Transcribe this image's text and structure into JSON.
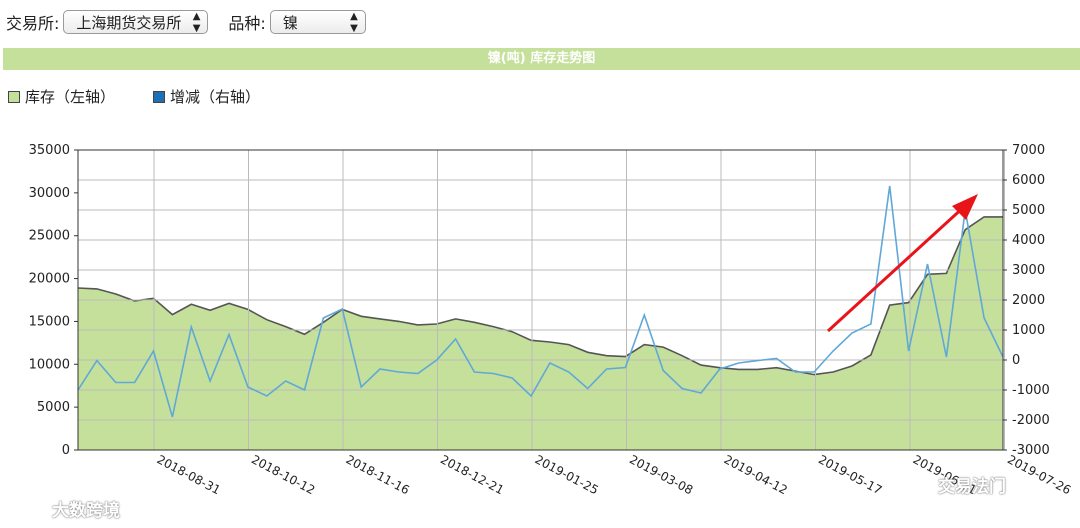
{
  "toolbar": {
    "exchange_label": "交易所:",
    "exchange_value": "上海期货交易所",
    "variety_label": "品种:",
    "variety_value": "镍"
  },
  "colors": {
    "inventory_fill": "#c5e09b",
    "inventory_line": "#555555",
    "change_line": "#5fa8d8",
    "arrow": "#e8141a",
    "grid": "#bbbbbb"
  },
  "watermarks": {
    "left": "大数跨境",
    "right": "交易法门"
  },
  "chart_data": {
    "type": "area",
    "title": "镍(吨)  库存走势图",
    "legend": [
      {
        "name": "库存（左轴）",
        "color": "#c5e09b"
      },
      {
        "name": "增减（右轴）",
        "color": "#1f6fb5"
      }
    ],
    "x_ticks": [
      "2018-08-31",
      "2018-10-12",
      "2018-11-16",
      "2018-12-21",
      "2019-01-25",
      "2019-03-08",
      "2019-04-12",
      "2019-05-17",
      "2019-06-21",
      "2019-07-26"
    ],
    "ylim_left": [
      0,
      35000
    ],
    "yticks_left": [
      "35000",
      "30000",
      "25000",
      "20000",
      "15000",
      "10000",
      "5000",
      "0"
    ],
    "ylim_right": [
      -3000,
      7000
    ],
    "yticks_right": [
      "7000",
      "6000",
      "5000",
      "4000",
      "3000",
      "2000",
      "1000",
      "0",
      "-1000",
      "-2000",
      "-3000"
    ],
    "grid": true,
    "legend_position": "top-left",
    "series": [
      {
        "name": "库存（左轴）",
        "axis": "left",
        "values": [
          18900,
          18800,
          18200,
          17400,
          17700,
          15800,
          17000,
          16300,
          17100,
          16400,
          15200,
          14400,
          13500,
          14900,
          16400,
          15600,
          15300,
          15000,
          14600,
          14700,
          15300,
          14900,
          14400,
          13800,
          12800,
          12600,
          12300,
          11400,
          11000,
          10900,
          12300,
          12000,
          11000,
          9900,
          9600,
          9400,
          9400,
          9600,
          9200,
          8800,
          9100,
          9800,
          11100,
          16900,
          17200,
          20500,
          20600,
          25700,
          27200,
          27200
        ]
      },
      {
        "name": "增减（右轴）",
        "axis": "right",
        "values": [
          -1000,
          -20,
          -750,
          -750,
          300,
          -1900,
          1100,
          -700,
          850,
          -900,
          -1200,
          -700,
          -1000,
          1400,
          1700,
          -900,
          -300,
          -400,
          -450,
          0,
          700,
          -400,
          -450,
          -600,
          -1200,
          -100,
          -400,
          -950,
          -300,
          -250,
          1500,
          -350,
          -950,
          -1100,
          -300,
          -100,
          -20,
          50,
          -400,
          -400,
          300,
          900,
          1200,
          5800,
          300,
          3200,
          100,
          5000,
          1400,
          100
        ]
      }
    ]
  }
}
